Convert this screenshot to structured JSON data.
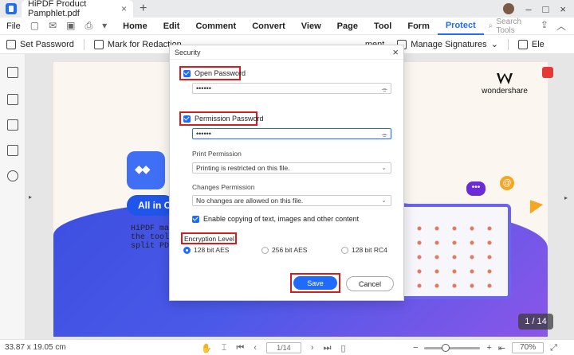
{
  "titlebar": {
    "tab_title": "HiPDF Product Pamphlet.pdf",
    "tab_close": "×",
    "new_tab": "+"
  },
  "menubar": {
    "file": "File",
    "items": [
      "Home",
      "Edit",
      "Comment",
      "Convert",
      "View",
      "Page",
      "Tool",
      "Form",
      "Protect"
    ],
    "active": "Protect",
    "search_tools": "Search Tools"
  },
  "toolbar": {
    "set_password": "Set Password",
    "mark_redaction": "Mark for Redaction",
    "comment_partial": "ment",
    "manage_signatures": "Manage Signatures",
    "ele_partial": "Ele"
  },
  "page": {
    "brand": "wondershare",
    "pill_text": "All in O",
    "body_lines": [
      "HiPDF makes",
      "the tools a",
      "split PDFs"
    ],
    "page_badge": "1 / 14"
  },
  "dialog": {
    "title": "Security",
    "open_password_label": "Open Password",
    "open_password_value": "••••••",
    "permission_password_label": "Permission Password",
    "permission_password_value": "••••••",
    "print_permission_label": "Print Permission",
    "print_permission_value": "Printing is restricted on this file.",
    "changes_permission_label": "Changes Permission",
    "changes_permission_value": "No changes are allowed on this file.",
    "enable_copying_label": "Enable copying of text, images and other content",
    "encryption_level_label": "Encryption Level",
    "encryption_options": [
      "128 bit AES",
      "256 bit AES",
      "128 bit RC4"
    ],
    "encryption_selected": "128 bit AES",
    "save_label": "Save",
    "cancel_label": "Cancel"
  },
  "statusbar": {
    "dimensions": "33.87 x 19.05 cm",
    "page_field": "1/14",
    "zoom": "70%"
  },
  "colors": {
    "accent": "#1f6bff",
    "highlight": "#d81b1b"
  }
}
